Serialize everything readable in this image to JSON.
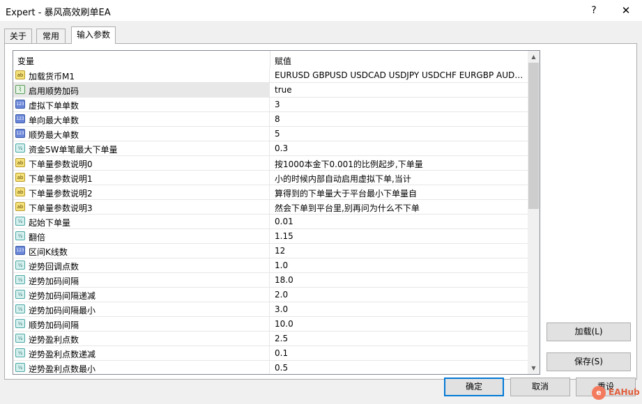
{
  "window": {
    "title": "Expert - 暴风高效刷单EA",
    "help_label": "?",
    "close_label": "✕"
  },
  "tabs": [
    {
      "label": "关于",
      "active": false
    },
    {
      "label": "常用",
      "active": false
    },
    {
      "label": "输入参数",
      "active": true
    }
  ],
  "table": {
    "headers": {
      "variable": "变量",
      "value": "赋值"
    },
    "rows": [
      {
        "type": "string",
        "icon": "ab",
        "name": "加载货币M1",
        "value": "EURUSD GBPUSD USDCAD USDJPY USDCHF  EURGBP AUDUSD NZDUSD"
      },
      {
        "type": "bool",
        "icon": "⌇",
        "name": "启用顺势加码",
        "value": "true"
      },
      {
        "type": "int",
        "icon": "123",
        "name": "虚拟下单单数",
        "value": "3"
      },
      {
        "type": "int",
        "icon": "123",
        "name": "单向最大单数",
        "value": "8"
      },
      {
        "type": "int",
        "icon": "123",
        "name": "顺势最大单数",
        "value": "5"
      },
      {
        "type": "double",
        "icon": "½",
        "name": "资金5W单笔最大下单量",
        "value": "0.3"
      },
      {
        "type": "string",
        "icon": "ab",
        "name": "下单量参数说明0",
        "value": "按1000本金下0.001的比例起步,下单量"
      },
      {
        "type": "string",
        "icon": "ab",
        "name": "下单量参数说明1",
        "value": "小的时候内部自动启用虚拟下单,当计"
      },
      {
        "type": "string",
        "icon": "ab",
        "name": "下单量参数说明2",
        "value": "算得到的下单量大于平台最小下单量自"
      },
      {
        "type": "string",
        "icon": "ab",
        "name": "下单量参数说明3",
        "value": "然会下单到平台里,别再问为什么不下单"
      },
      {
        "type": "double",
        "icon": "½",
        "name": "起始下单量",
        "value": "0.01"
      },
      {
        "type": "double",
        "icon": "½",
        "name": "翻倍",
        "value": "1.15"
      },
      {
        "type": "int",
        "icon": "123",
        "name": "区间K线数",
        "value": "12"
      },
      {
        "type": "double",
        "icon": "½",
        "name": "逆势回调点数",
        "value": "1.0"
      },
      {
        "type": "double",
        "icon": "½",
        "name": "逆势加码间隔",
        "value": "18.0"
      },
      {
        "type": "double",
        "icon": "½",
        "name": "逆势加码间隔递减",
        "value": "2.0"
      },
      {
        "type": "double",
        "icon": "½",
        "name": "逆势加码间隔最小",
        "value": "3.0"
      },
      {
        "type": "double",
        "icon": "½",
        "name": "顺势加码间隔",
        "value": "10.0"
      },
      {
        "type": "double",
        "icon": "½",
        "name": "逆势盈利点数",
        "value": "2.5"
      },
      {
        "type": "double",
        "icon": "½",
        "name": "逆势盈利点数递减",
        "value": "0.1"
      },
      {
        "type": "double",
        "icon": "½",
        "name": "逆势盈利点数最小",
        "value": "0.5"
      }
    ]
  },
  "scrollbar": {
    "up_icon": "▲",
    "down_icon": "▼"
  },
  "buttons": {
    "load": "加载(L)",
    "save": "保存(S)",
    "ok": "确定",
    "cancel": "取消",
    "reset": "重设"
  },
  "watermark": {
    "icon": "e",
    "text": "EAHub"
  }
}
